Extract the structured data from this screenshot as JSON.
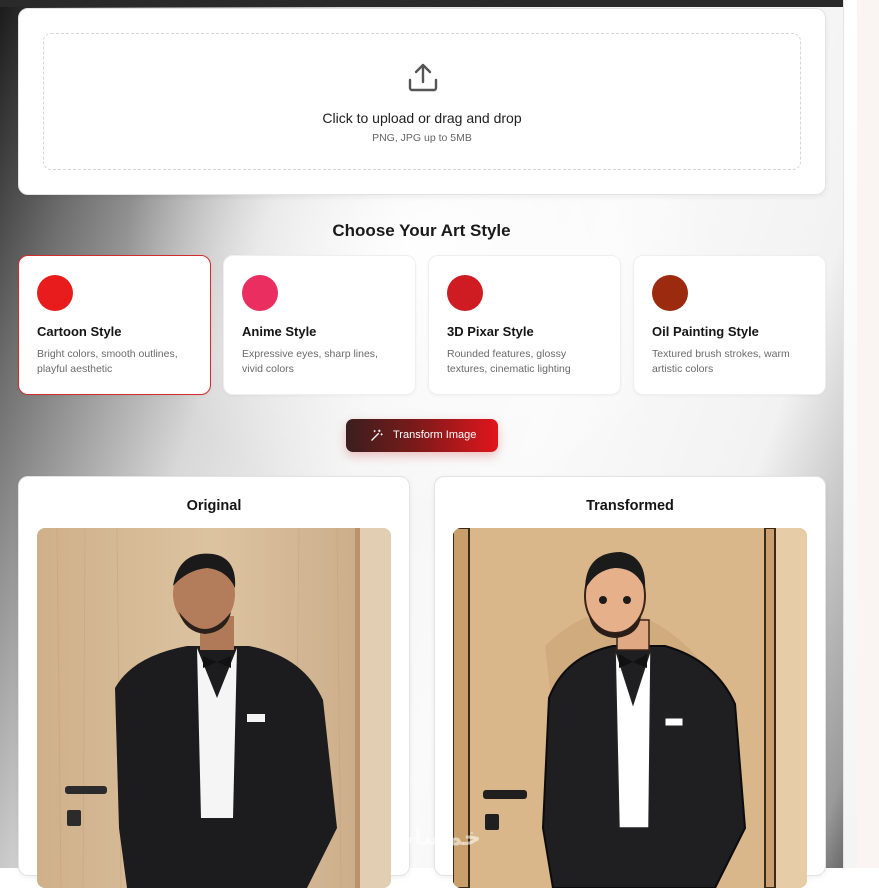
{
  "upload": {
    "title": "Click to upload or drag and drop",
    "subtitle": "PNG, JPG up to 5MB",
    "icon": "upload-icon"
  },
  "styles_section": {
    "title": "Choose Your Art Style",
    "selected": "Cartoon Style",
    "items": [
      {
        "name": "Cartoon Style",
        "desc": "Bright colors, smooth outlines, playful aesthetic",
        "color": "#e81c1c"
      },
      {
        "name": "Anime Style",
        "desc": "Expressive eyes, sharp lines, vivid colors",
        "color": "#ea2e5f"
      },
      {
        "name": "3D Pixar Style",
        "desc": "Rounded features, glossy textures, cinematic lighting",
        "color": "#cf1b22"
      },
      {
        "name": "Oil Painting Style",
        "desc": "Textured brush strokes, warm artistic colors",
        "color": "#9c2a0e"
      }
    ]
  },
  "transform_button": {
    "label": "Transform Image",
    "icon": "magic-wand-icon"
  },
  "results": {
    "original_title": "Original",
    "transformed_title": "Transformed"
  },
  "watermark": "خمسات"
}
